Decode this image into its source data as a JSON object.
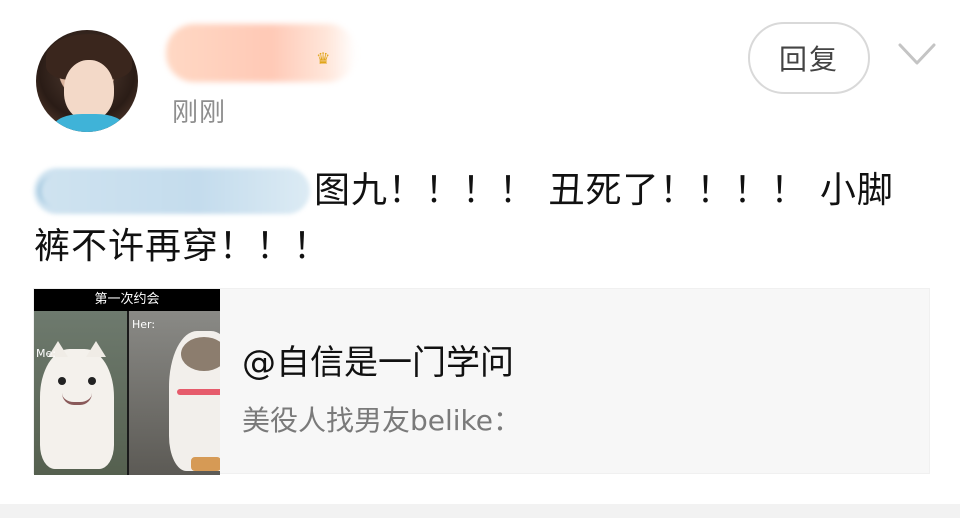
{
  "comment": {
    "timestamp": "刚刚",
    "line1": "图九！！！！ 丑死了！！！！ 小脚",
    "line2": "裤不许再穿！！！"
  },
  "header": {
    "reply_label": "回复"
  },
  "shared_card": {
    "title": "@自信是一门学问",
    "subtitle": "美役人找男友belike：",
    "thumb_caption": "第一次约会",
    "thumb_label_left": "Me:",
    "thumb_label_right": "Her:"
  },
  "icons": {
    "chevron": "chevron-down-icon",
    "badge": "crown-icon"
  },
  "colors": {
    "timestamp": "#8e8e8e",
    "reply_border": "#d9d9d9",
    "card_bg": "#f7f7f7",
    "subtitle": "#7a7a7a"
  }
}
